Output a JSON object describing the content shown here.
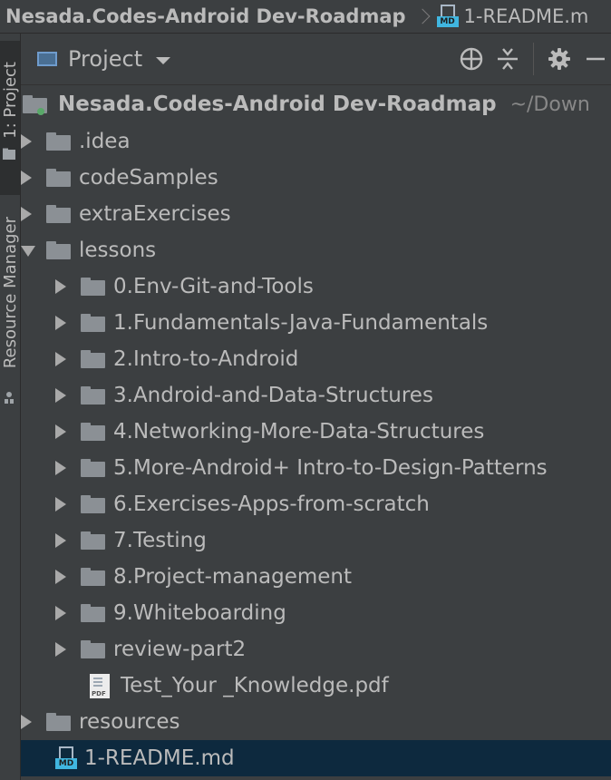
{
  "breadcrumb": {
    "project": "Nesada.Codes-Android Dev-Roadmap",
    "file": "1-README.m",
    "file_icon_badge": "MD"
  },
  "tool_stripe": {
    "project_tab": "1: Project",
    "resource_tab": "Resource Manager"
  },
  "panel": {
    "view_selector": "Project",
    "tools": [
      "crosshair-icon",
      "collapse-all-icon",
      "gear-icon",
      "minimize-icon"
    ]
  },
  "tree": {
    "root": {
      "name": "Nesada.Codes-Android Dev-Roadmap",
      "path_hint": "~/Down"
    },
    "items": [
      {
        "name": ".idea"
      },
      {
        "name": "codeSamples"
      },
      {
        "name": "extraExercises"
      },
      {
        "name": "lessons"
      },
      {
        "name": "0.Env-Git-and-Tools"
      },
      {
        "name": "1.Fundamentals-Java-Fundamentals"
      },
      {
        "name": "2.Intro-to-Android"
      },
      {
        "name": "3.Android-and-Data-Structures"
      },
      {
        "name": "4.Networking-More-Data-Structures"
      },
      {
        "name": "5.More-Android+ Intro-to-Design-Patterns"
      },
      {
        "name": "6.Exercises-Apps-from-scratch"
      },
      {
        "name": "7.Testing"
      },
      {
        "name": "8.Project-management"
      },
      {
        "name": "9.Whiteboarding"
      },
      {
        "name": "review-part2"
      },
      {
        "name": "Test_Your _Knowledge.pdf",
        "icon_text": "PDF"
      },
      {
        "name": "resources"
      },
      {
        "name": "1-README.md",
        "icon_text": "MD"
      }
    ]
  },
  "colors": {
    "panel_bg": "#3c3f41",
    "selected_row": "#0d293e",
    "folder": "#8b9095",
    "text": "#bbbbbb",
    "md_badge": "#40b6e0"
  }
}
